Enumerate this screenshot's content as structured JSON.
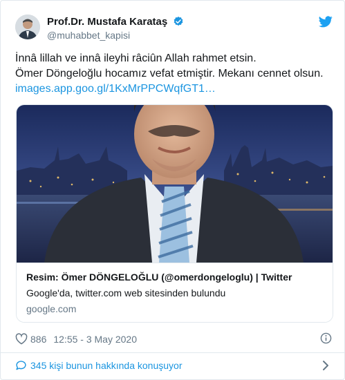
{
  "author": {
    "name": "Prof.Dr. Mustafa Karataş",
    "handle": "@muhabbet_kapisi",
    "verified": true
  },
  "tweet": {
    "line1": "İnnâ lillah ve innâ ileyhi râciûn  Allah rahmet etsin.",
    "line2": "Ömer Döngeloğlu hocamız vefat etmiştir. Mekanı cennet olsun.",
    "link": "images.app.goo.gl/1KxMrPPCWqfGT1…"
  },
  "card": {
    "title": "Resim: Ömer DÖNGELOĞLU (@omerdongeloglu) | Twitter",
    "description": "Google'da, twitter.com web sitesinden bulundu",
    "domain": "google.com"
  },
  "stats": {
    "likes": "886",
    "timestamp": "12:55 - 3 May 2020"
  },
  "footer": {
    "conversation": "345 kişi bunun hakkında konuşuyor"
  },
  "colors": {
    "accent": "#1b95e0",
    "text": "#14171a",
    "muted": "#657786",
    "like_icon": "#657786",
    "border": "#e1e8ed"
  },
  "icons": [
    "twitter-bird-icon",
    "verified-badge-icon",
    "heart-icon",
    "info-icon",
    "speech-bubble-icon",
    "chevron-right-icon"
  ]
}
